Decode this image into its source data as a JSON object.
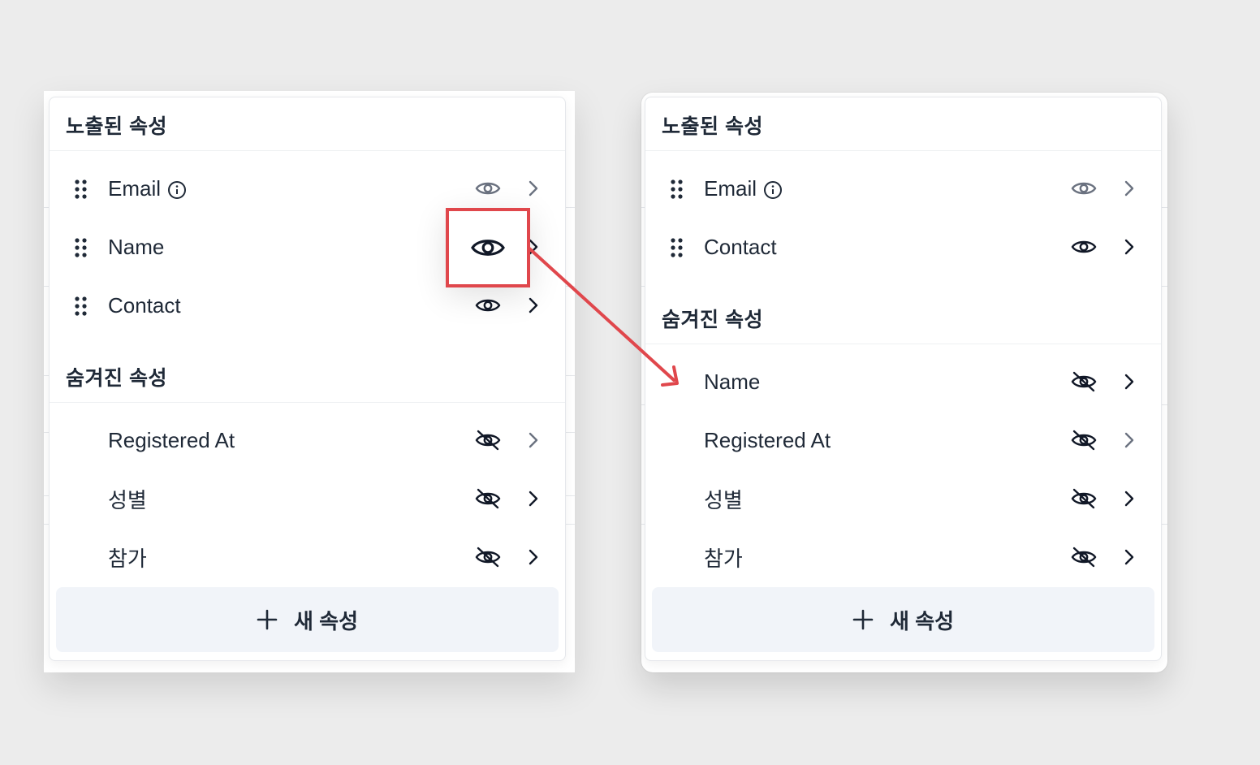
{
  "colors": {
    "annotation": "#e0474c",
    "panel_bg": "#ffffff",
    "add_button_bg": "#f1f4f9",
    "icon_muted": "#6b7280",
    "icon_dark": "#111827"
  },
  "left_panel": {
    "visible_section_title": "노출된 속성",
    "hidden_section_title": "숨겨진 속성",
    "visible_items": [
      {
        "label": "Email",
        "icon": "eye-icon",
        "has_info": true
      },
      {
        "label": "Name",
        "icon": "eye-icon",
        "has_info": false,
        "highlighted": true
      },
      {
        "label": "Contact",
        "icon": "eye-icon",
        "has_info": false
      }
    ],
    "hidden_items": [
      {
        "label": "Registered At",
        "icon": "eye-off-icon"
      },
      {
        "label": "성별",
        "icon": "eye-off-icon"
      },
      {
        "label": "참가",
        "icon": "eye-off-icon"
      }
    ],
    "add_button_label": "새 속성"
  },
  "right_panel": {
    "visible_section_title": "노출된 속성",
    "hidden_section_title": "숨겨진 속성",
    "visible_items": [
      {
        "label": "Email",
        "icon": "eye-icon",
        "has_info": true
      },
      {
        "label": "Contact",
        "icon": "eye-icon",
        "has_info": false
      }
    ],
    "hidden_items": [
      {
        "label": "Name",
        "icon": "eye-off-icon"
      },
      {
        "label": "Registered At",
        "icon": "eye-off-icon"
      },
      {
        "label": "성별",
        "icon": "eye-off-icon"
      },
      {
        "label": "참가",
        "icon": "eye-off-icon"
      }
    ],
    "add_button_label": "새 속성"
  }
}
